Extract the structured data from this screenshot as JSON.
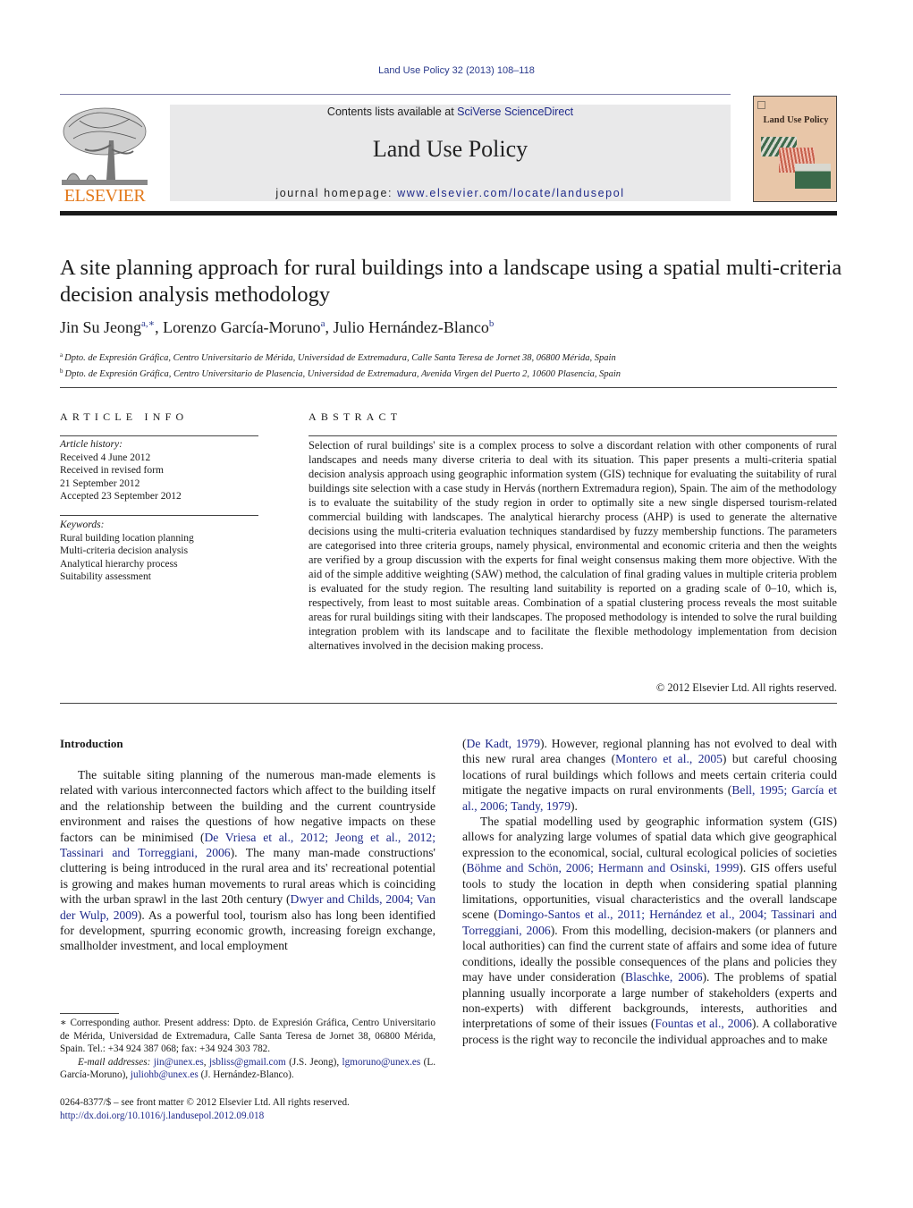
{
  "header": {
    "journal_reference": "Land Use Policy 32 (2013) 108–118",
    "contents_prefix": "Contents lists available at ",
    "contents_link": "SciVerse ScienceDirect",
    "journal_name": "Land Use Policy",
    "homepage_prefix": "journal homepage: ",
    "homepage_link": "www.elsevier.com/locate/landusepol",
    "publisher_logo_text": "ELSEVIER",
    "cover_title": "Land Use Policy",
    "colors": {
      "link": "#1f2a8a",
      "elsevier_orange": "#e37a1c",
      "banner_bg": "#e9e9ea",
      "cover_bg": "#e8c6a8"
    }
  },
  "article": {
    "title": "A site planning approach for rural buildings into a landscape using a spatial multi-criteria decision analysis methodology",
    "authors": [
      {
        "name": "Jin Su Jeong",
        "sup": "a,∗",
        "sep": ", "
      },
      {
        "name": "Lorenzo García-Moruno",
        "sup": "a",
        "sep": ", "
      },
      {
        "name": "Julio Hernández-Blanco",
        "sup": "b",
        "sep": ""
      }
    ],
    "affiliations": [
      {
        "mark": "a",
        "text": "Dpto. de Expresión Gráfica, Centro Universitario de Mérida, Universidad de Extremadura, Calle Santa Teresa de Jornet 38, 06800 Mérida, Spain"
      },
      {
        "mark": "b",
        "text": "Dpto. de Expresión Gráfica, Centro Universitario de Plasencia, Universidad de Extremadura, Avenida Virgen del Puerto 2, 10600 Plasencia, Spain"
      }
    ]
  },
  "article_info": {
    "heading": "ARTICLE INFO",
    "history_label": "Article history:",
    "history": [
      "Received 4 June 2012",
      "Received in revised form",
      "21 September 2012",
      "Accepted 23 September 2012"
    ],
    "keywords_label": "Keywords:",
    "keywords": [
      "Rural building location planning",
      "Multi-criteria decision analysis",
      "Analytical hierarchy process",
      "Suitability assessment"
    ]
  },
  "abstract": {
    "heading": "ABSTRACT",
    "text": "Selection of rural buildings' site is a complex process to solve a discordant relation with other compo­nents of rural landscapes and needs many diverse criteria to deal with its situation. This paper presents a multi-criteria spatial decision analysis approach using geographic information system (GIS) technique for evaluating the suitability of rural buildings site selection with a case study in Hervás (northern Extremadura region), Spain. The aim of the methodology is to evaluate the suitability of the study region in order to optimally site a new single dispersed tourism-related commercial building with landscapes. The analytical hierarchy process (AHP) is used to generate the alternative decisions using the multi-criteria evaluation techniques standardised by fuzzy membership functions. The parameters are categorised into three criteria groups, namely physical, environmental and economic criteria and then the weights are verified by a group discussion with the experts for final weight consensus making them more objective. With the aid of the simple additive weighting (SAW) method, the calculation of final grading values in multiple criteria problem is evaluated for the study region. The resulting land suitability is reported on a grading scale of 0–10, which is, respectively, from least to most suitable areas. Combination of a spa­tial clustering process reveals the most suitable areas for rural buildings siting with their landscapes. The proposed methodology is intended to solve the rural building integration problem with its landscape and to facilitate the flexible methodology implementation from decision alternatives involved in the decision making process.",
    "copyright": "© 2012 Elsevier Ltd. All rights reserved."
  },
  "body": {
    "section_heading": "Introduction",
    "left_paragraph": [
      {
        "t": "The suitable siting planning of the numerous man-made ele­ments is related with various interconnected factors which affect to the building itself and the relationship between the building and the current countryside environment and raises the questions of how negative impacts on these factors can be minimised ("
      },
      {
        "link": "De Vriesa et al., 2012; Jeong et al., 2012; Tassinari and Torreggiani, 2006"
      },
      {
        "t": "). The many man-made constructions' cluttering is being introduced in the rural area and its' recreational potential is growing and makes human movements to rural areas which is coinciding with the urban sprawl in the last 20th century ("
      },
      {
        "link": "Dwyer and Childs, 2004; Van der Wulp, 2009"
      },
      {
        "t": "). As a powerful tool, tourism also has long been identified for development, spurring economic growth, increasing foreign exchange, smallholder investment, and local employment"
      }
    ],
    "right_paragraph_1": [
      {
        "t": "("
      },
      {
        "link": "De Kadt, 1979"
      },
      {
        "t": "). However, regional planning has not evolved to deal with this new rural area changes ("
      },
      {
        "link": "Montero et al., 2005"
      },
      {
        "t": ") but care­ful choosing locations of rural buildings which follows and meets certain criteria could mitigate the negative impacts on rural envi­ronments ("
      },
      {
        "link": "Bell, 1995; García et al., 2006; Tandy, 1979"
      },
      {
        "t": ")."
      }
    ],
    "right_paragraph_2": [
      {
        "t": "The spatial modelling used by geographic information system (GIS) allows for analyzing large volumes of spatial data which give geographical expression to the economical, social, cultural eco­logical policies of societies ("
      },
      {
        "link": "Böhme and Schön, 2006; Hermann and Osinski, 1999"
      },
      {
        "t": "). GIS offers useful tools to study the location in depth when considering spatial planning limitations, oppor­tunities, visual characteristics and the overall landscape scene ("
      },
      {
        "link": "Domingo-Santos et al., 2011; Hernández et al., 2004; Tassinari and Torreggiani, 2006"
      },
      {
        "t": "). From this modelling, decision-makers (or plan­ners and local authorities) can find the current state of affairs and some idea of future conditions, ideally the possible consequences of the plans and policies they may have under consideration ("
      },
      {
        "link": "Blaschke, 2006"
      },
      {
        "t": "). The problems of spatial planning usually incorpo­rate a large number of stakeholders (experts and non-experts) with different backgrounds, interests, authorities and interpretations of some of their issues ("
      },
      {
        "link": "Fountas et al., 2006"
      },
      {
        "t": "). A collaborative process is the right way to reconcile the individual approaches and to make"
      }
    ]
  },
  "footnote": {
    "corresponding": "∗ Corresponding author. Present address: Dpto. de Expresión Gráfica, Centro Uni­versitario de Mérida, Universidad de Extremadura, Calle Santa Teresa de Jornet 38, 06800 Mérida, Spain. Tel.: +34 924 387 068; fax: +34 924 303 782.",
    "email_label": "E-mail addresses: ",
    "emails": [
      {
        "link": "jin@unex.es",
        "after": ", "
      },
      {
        "link": "jsbliss@gmail.com",
        "after": " (J.S. Jeong), "
      },
      {
        "link": "lgmoruno@unex.es",
        "after": " (L. García-Moruno), "
      },
      {
        "link": "juliohb@unex.es",
        "after": " (J. Hernández-Blanco)."
      }
    ],
    "issn_line": "0264-8377/$ – see front matter © 2012 Elsevier Ltd. All rights reserved.",
    "doi": "http://dx.doi.org/10.1016/j.landusepol.2012.09.018"
  }
}
